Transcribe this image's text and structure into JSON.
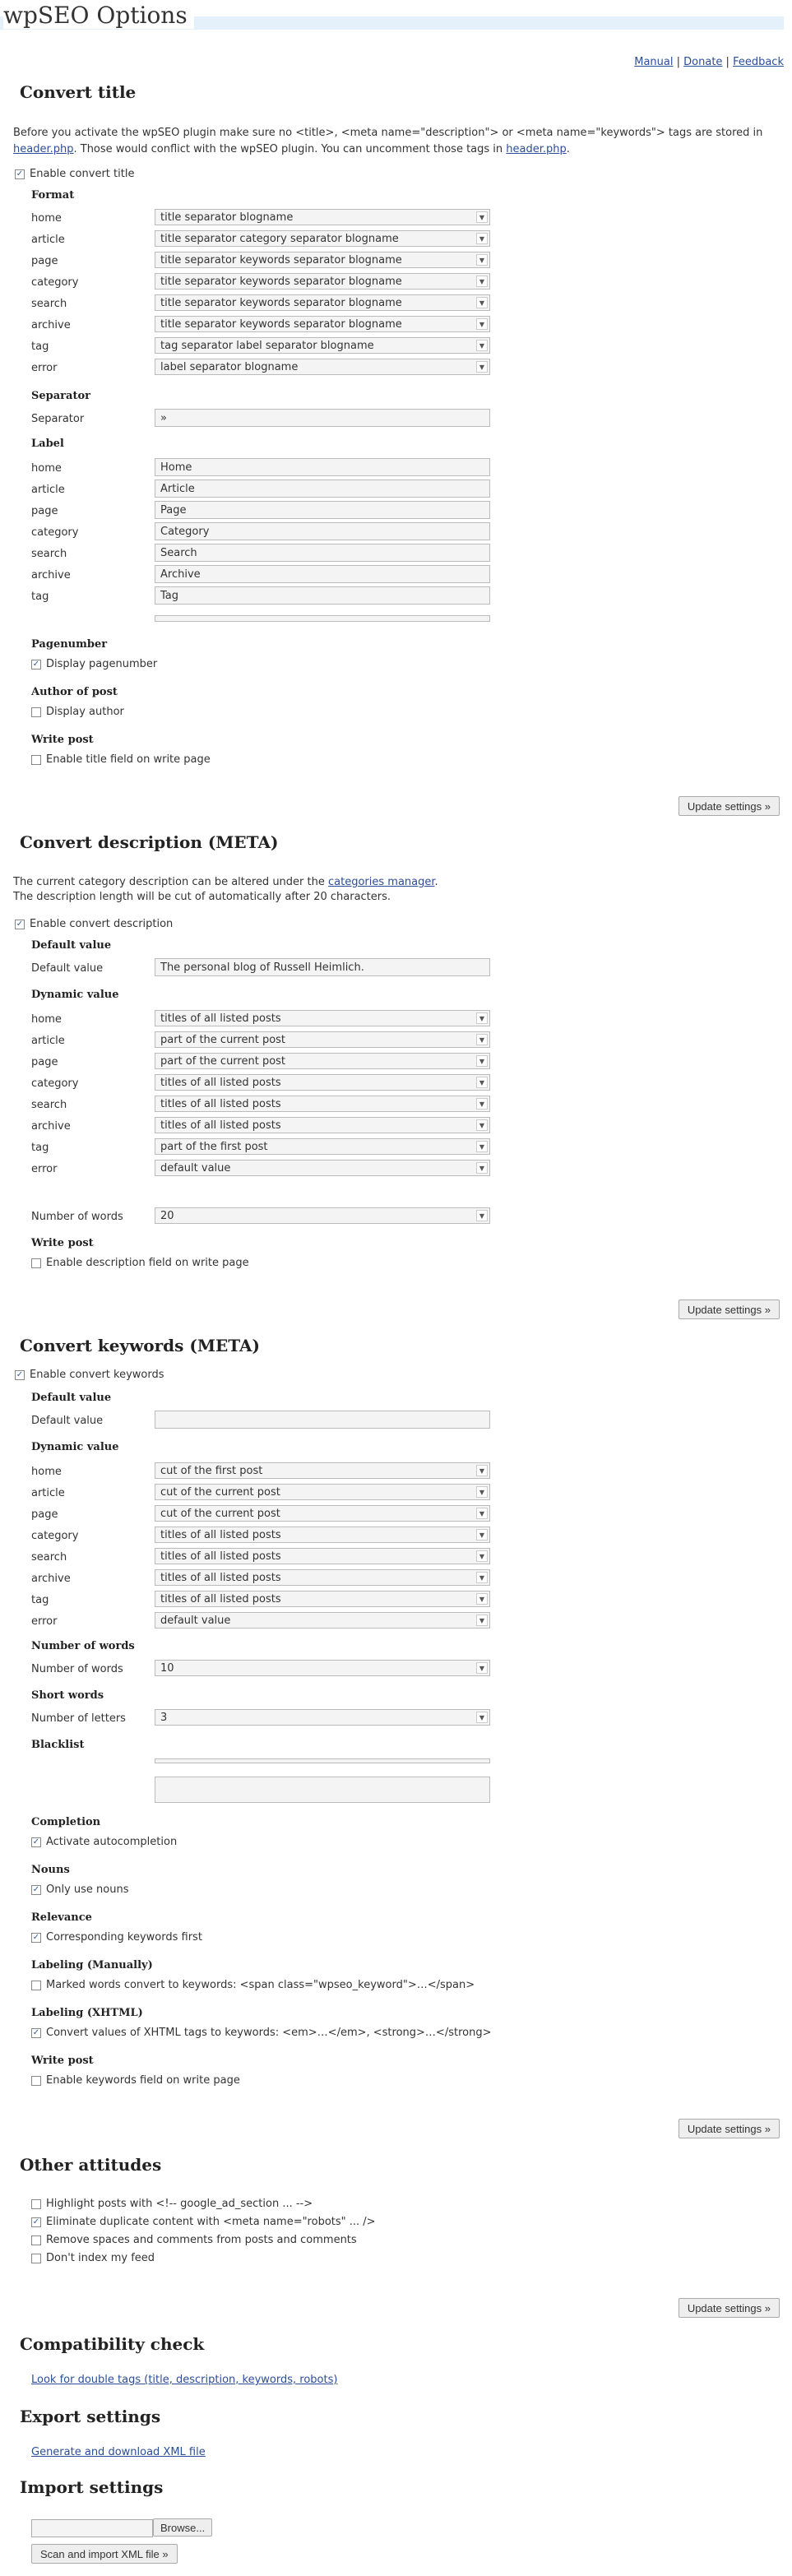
{
  "page": {
    "title": "wpSEO Options",
    "links": {
      "manual": "Manual",
      "donate": "Donate",
      "feedback": "Feedback",
      "sep": " | "
    }
  },
  "title_section": {
    "heading": "Convert title",
    "intro1": "Before you activate the wpSEO plugin make sure no <title>, <meta name=\"description\"> or <meta name=\"keywords\"> tags are stored in",
    "intro2_link": "header.php",
    "intro2_text": ". Those would conflict with the wpSEO plugin. You can uncomment those tags in ",
    "intro2_link2": "header.php",
    "intro2_end": ".",
    "enable": "Enable convert title",
    "format_heading": "Format",
    "format": [
      {
        "label": "home",
        "value": "title separator blogname"
      },
      {
        "label": "article",
        "value": "title separator category separator blogname"
      },
      {
        "label": "page",
        "value": "title separator keywords separator blogname"
      },
      {
        "label": "category",
        "value": "title separator keywords separator blogname"
      },
      {
        "label": "search",
        "value": "title separator keywords separator blogname"
      },
      {
        "label": "archive",
        "value": "title separator keywords separator blogname"
      },
      {
        "label": "tag",
        "value": "tag separator label separator blogname"
      },
      {
        "label": "error",
        "value": "label separator blogname"
      }
    ],
    "separator_heading": "Separator",
    "separator_label": "Separator",
    "separator_value": "»",
    "label_heading": "Label",
    "labels": [
      {
        "label": "home",
        "value": "Home"
      },
      {
        "label": "article",
        "value": "Article"
      },
      {
        "label": "page",
        "value": "Page"
      },
      {
        "label": "category",
        "value": "Category"
      },
      {
        "label": "search",
        "value": "Search"
      },
      {
        "label": "archive",
        "value": "Archive"
      },
      {
        "label": "tag",
        "value": "Tag"
      }
    ],
    "pagenumber_heading": "Pagenumber",
    "pagenumber_check": "Display pagenumber",
    "author_heading": "Author of post",
    "author_check": "Display author",
    "write_heading": "Write post",
    "write_check": "Enable title field on write page",
    "update": "Update settings »"
  },
  "desc_section": {
    "heading": "Convert description (META)",
    "intro1_text": "The current category description can be altered under the ",
    "intro1_link": "categories manager",
    "intro1_end": ".",
    "intro2": "The description length will be cut of automatically after 20 characters.",
    "enable": "Enable convert description",
    "default_heading": "Default value",
    "default_label": "Default value",
    "default_value": "The personal blog of Russell Heimlich.",
    "dynamic_heading": "Dynamic value",
    "dynamic": [
      {
        "label": "home",
        "value": "titles of all listed posts"
      },
      {
        "label": "article",
        "value": "part of the current post"
      },
      {
        "label": "page",
        "value": "part of the current post"
      },
      {
        "label": "category",
        "value": "titles of all listed posts"
      },
      {
        "label": "search",
        "value": "titles of all listed posts"
      },
      {
        "label": "archive",
        "value": "titles of all listed posts"
      },
      {
        "label": "tag",
        "value": "part of the first post"
      },
      {
        "label": "error",
        "value": "default value"
      }
    ],
    "words_label": "Number of words",
    "words_value": "20",
    "write_heading": "Write post",
    "write_check": "Enable description field on write page",
    "update": "Update settings »"
  },
  "kw_section": {
    "heading": "Convert keywords (META)",
    "enable": "Enable convert keywords",
    "default_heading": "Default value",
    "default_label": "Default value",
    "dynamic_heading": "Dynamic value",
    "dynamic": [
      {
        "label": "home",
        "value": "cut of the first post"
      },
      {
        "label": "article",
        "value": "cut of the current post"
      },
      {
        "label": "page",
        "value": "cut of the current post"
      },
      {
        "label": "category",
        "value": "titles of all listed posts"
      },
      {
        "label": "search",
        "value": "titles of all listed posts"
      },
      {
        "label": "archive",
        "value": "titles of all listed posts"
      },
      {
        "label": "tag",
        "value": "titles of all listed posts"
      },
      {
        "label": "error",
        "value": "default value"
      }
    ],
    "words_heading": "Number of words",
    "words_label": "Number of words",
    "words_value": "10",
    "short_heading": "Short words",
    "short_label": "Number of letters",
    "short_value": "3",
    "blacklist_heading": "Blacklist",
    "completion_heading": "Completion",
    "completion_check": "Activate autocompletion",
    "nouns_heading": "Nouns",
    "nouns_check": "Only use nouns",
    "relevance_heading": "Relevance",
    "relevance_check": "Corresponding keywords first",
    "labeling_manual_heading": "Labeling (Manually)",
    "labeling_manual_check": "Marked words convert to keywords: <span class=\"wpseo_keyword\">…</span>",
    "labeling_xhtml_heading": "Labeling (XHTML)",
    "labeling_xhtml_check": "Convert values of XHTML tags to keywords: <em>…</em>, <strong>…</strong>",
    "write_heading": "Write post",
    "write_check": "Enable keywords field on write page",
    "update": "Update settings »"
  },
  "other_section": {
    "heading": "Other attitudes",
    "checks": [
      {
        "label": "Highlight posts with <!-- google_ad_section ... -->",
        "checked": false
      },
      {
        "label": "Eliminate duplicate content with <meta name=\"robots\" ... />",
        "checked": true
      },
      {
        "label": "Remove spaces and comments from posts and comments",
        "checked": false
      },
      {
        "label": "Don't index my feed",
        "checked": false
      }
    ],
    "update": "Update settings »"
  },
  "compat_section": {
    "heading": "Compatibility check",
    "link": "Look for double tags (title, description, keywords, robots)"
  },
  "export_section": {
    "heading": "Export settings",
    "link": "Generate and download XML file"
  },
  "import_section": {
    "heading": "Import settings",
    "browse": "Browse...",
    "scan": "Scan and import XML file »"
  }
}
